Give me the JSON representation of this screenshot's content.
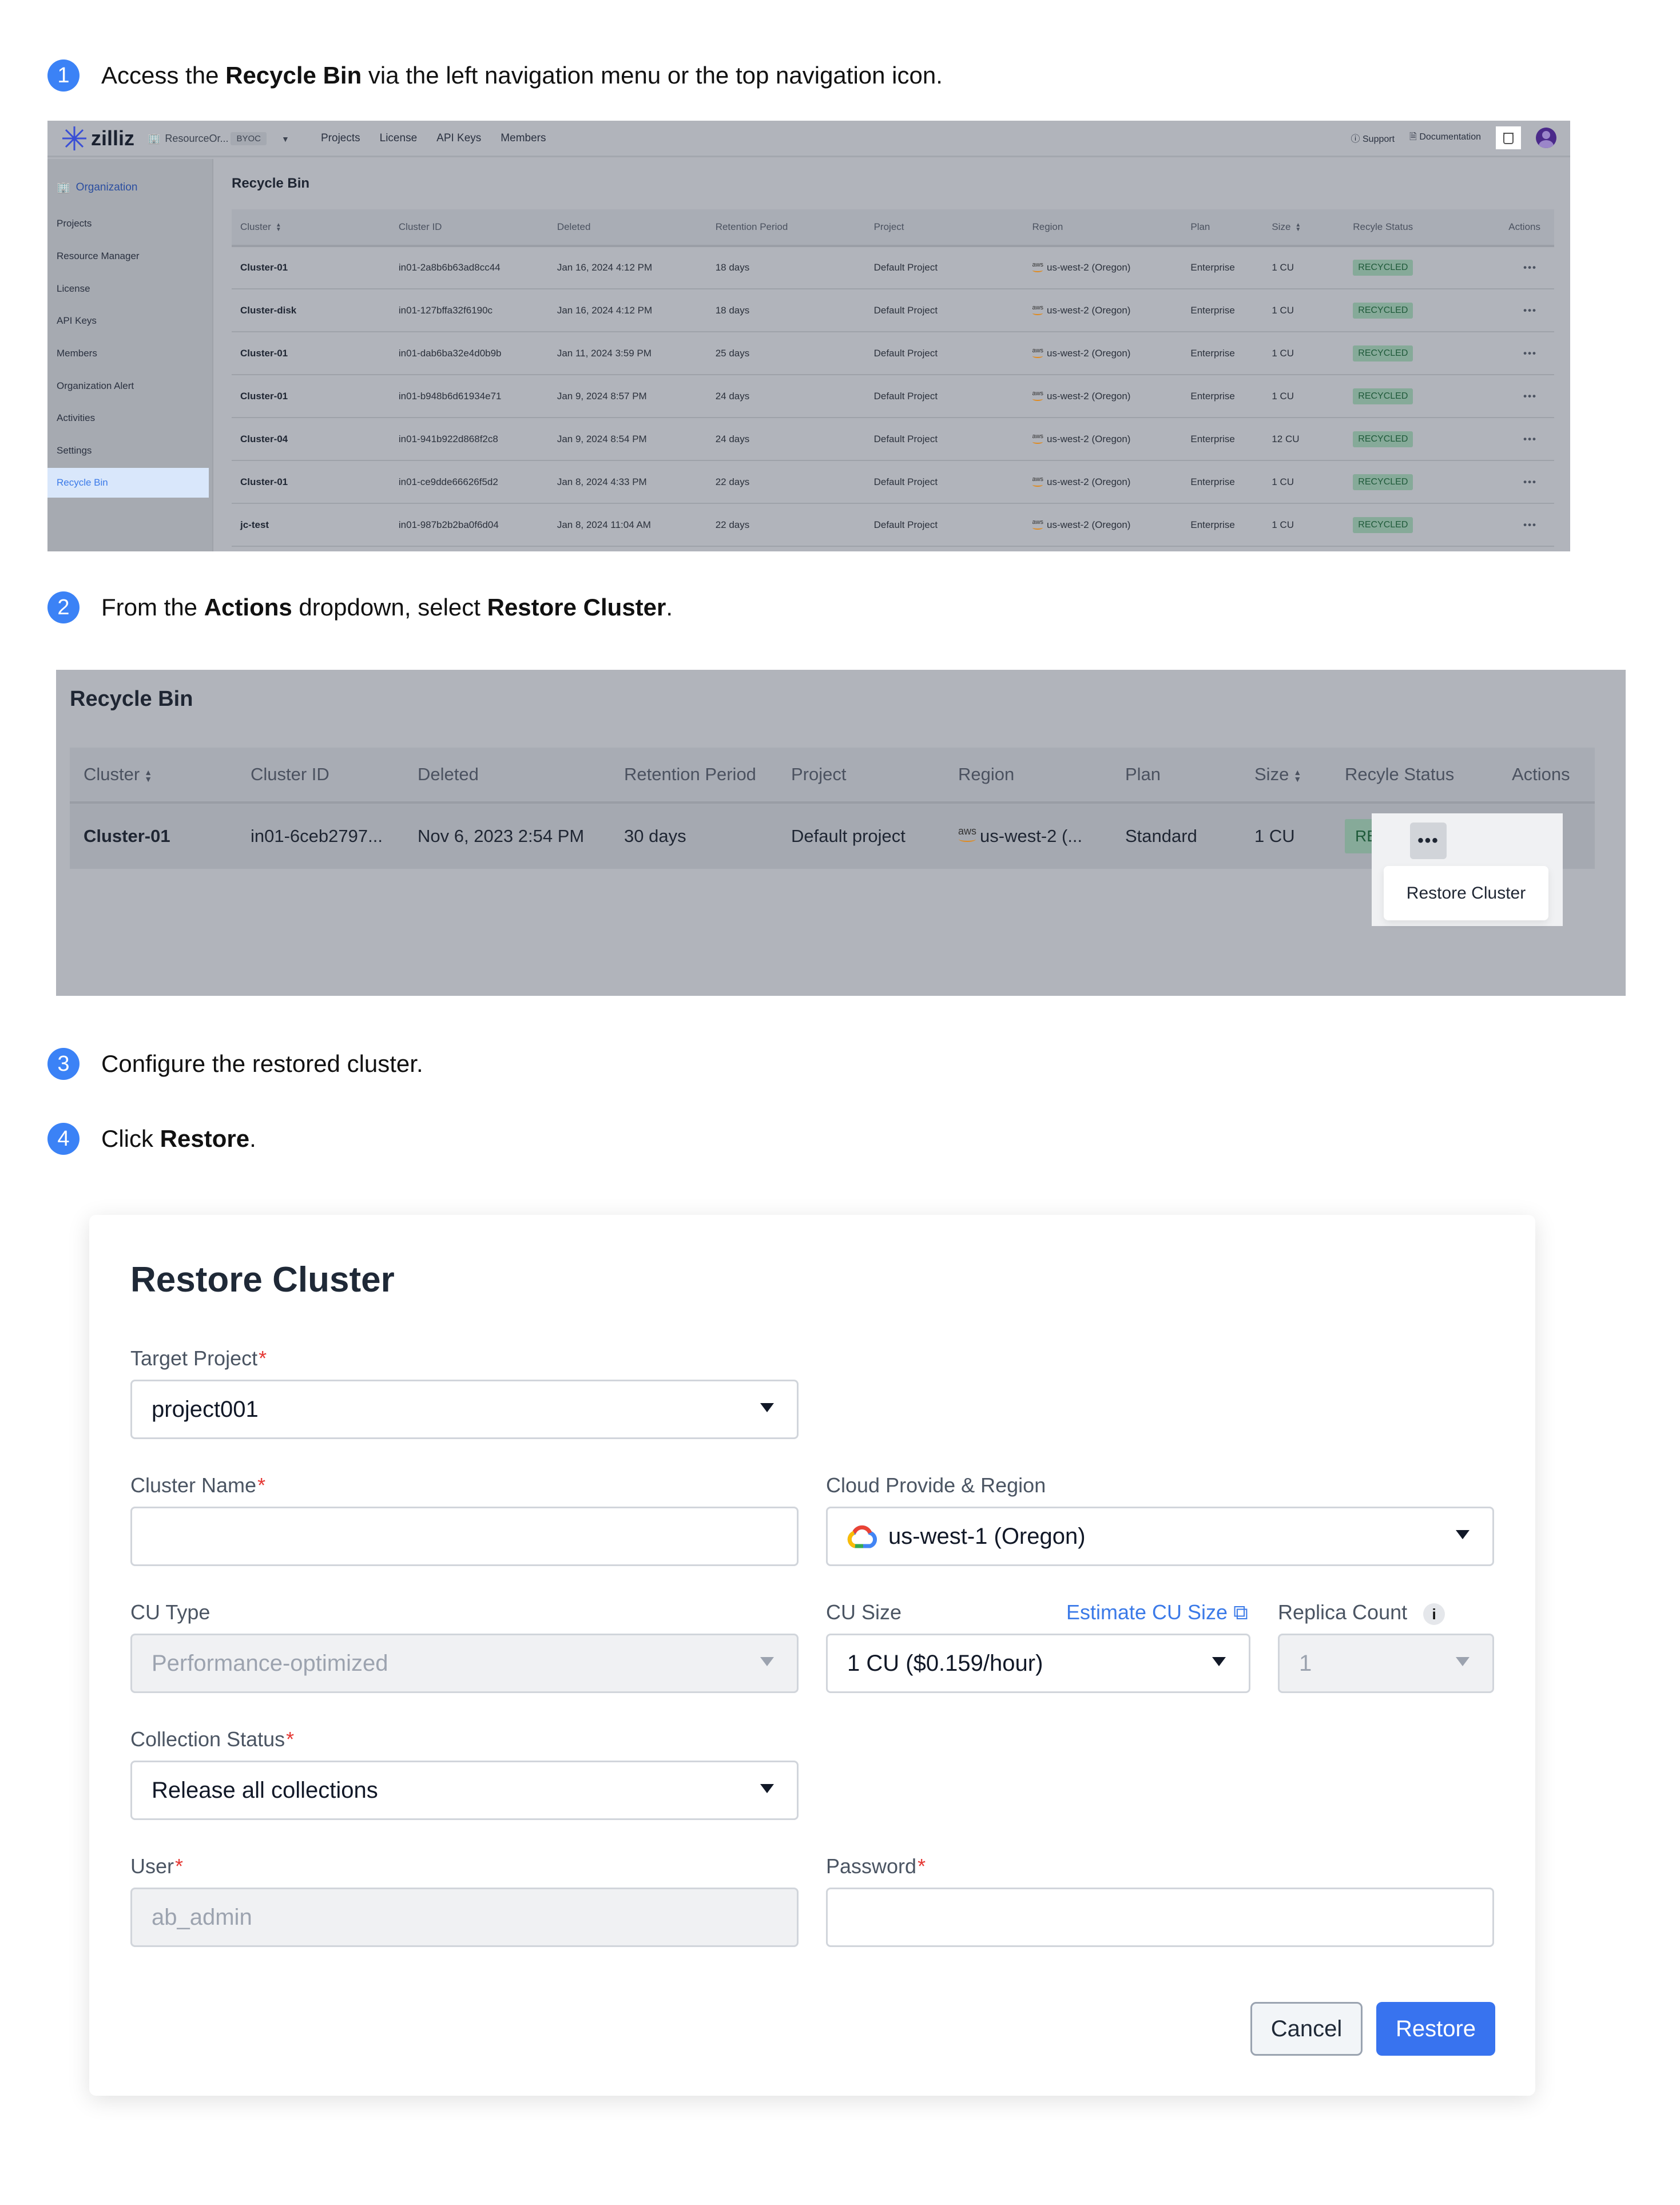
{
  "steps": [
    {
      "num": "1",
      "pre": "Access the ",
      "bold": "Recycle Bin",
      "post": " via the left navigation menu or the top navigation icon."
    },
    {
      "num": "2",
      "pre": "From the ",
      "bold": "Actions",
      "mid": " dropdown, select ",
      "bold2": "Restore Cluster",
      "post": "."
    },
    {
      "num": "3",
      "text": "Configure the restored cluster."
    },
    {
      "num": "4",
      "pre": "Click ",
      "bold": "Restore",
      "post": "."
    }
  ],
  "console": {
    "brand": "zilliz",
    "org_name": "ResourceOr...",
    "org_badge": "BYOC",
    "nav": [
      "Projects",
      "License",
      "API Keys",
      "Members"
    ],
    "support": "Support",
    "documentation": "Documentation",
    "sidebar": {
      "org": "Organization",
      "items": [
        "Projects",
        "Resource Manager",
        "License",
        "API Keys",
        "Members",
        "Organization Alert",
        "Activities",
        "Settings"
      ],
      "active": "Recycle Bin"
    },
    "page_title": "Recycle Bin",
    "columns": [
      "Cluster",
      "Cluster ID",
      "Deleted",
      "Retention Period",
      "Project",
      "Region",
      "Plan",
      "Size",
      "Recyle Status",
      "Actions"
    ],
    "rows": [
      {
        "cluster": "Cluster-01",
        "id": "in01-2a8b6b63ad8cc44",
        "deleted": "Jan 16, 2024 4:12 PM",
        "retention": "18 days",
        "project": "Default Project",
        "region": "us-west-2 (Oregon)",
        "plan": "Enterprise",
        "size": "1 CU",
        "status": "RECYCLED"
      },
      {
        "cluster": "Cluster-disk",
        "id": "in01-127bffa32f6190c",
        "deleted": "Jan 16, 2024 4:12 PM",
        "retention": "18 days",
        "project": "Default Project",
        "region": "us-west-2 (Oregon)",
        "plan": "Enterprise",
        "size": "1 CU",
        "status": "RECYCLED"
      },
      {
        "cluster": "Cluster-01",
        "id": "in01-dab6ba32e4d0b9b",
        "deleted": "Jan 11, 2024 3:59 PM",
        "retention": "25 days",
        "project": "Default Project",
        "region": "us-west-2 (Oregon)",
        "plan": "Enterprise",
        "size": "1 CU",
        "status": "RECYCLED"
      },
      {
        "cluster": "Cluster-01",
        "id": "in01-b948b6d61934e71",
        "deleted": "Jan 9, 2024 8:57 PM",
        "retention": "24 days",
        "project": "Default Project",
        "region": "us-west-2 (Oregon)",
        "plan": "Enterprise",
        "size": "1 CU",
        "status": "RECYCLED"
      },
      {
        "cluster": "Cluster-04",
        "id": "in01-941b922d868f2c8",
        "deleted": "Jan 9, 2024 8:54 PM",
        "retention": "24 days",
        "project": "Default Project",
        "region": "us-west-2 (Oregon)",
        "plan": "Enterprise",
        "size": "12 CU",
        "status": "RECYCLED"
      },
      {
        "cluster": "Cluster-01",
        "id": "in01-ce9dde66626f5d2",
        "deleted": "Jan 8, 2024 4:33 PM",
        "retention": "22 days",
        "project": "Default Project",
        "region": "us-west-2 (Oregon)",
        "plan": "Enterprise",
        "size": "1 CU",
        "status": "RECYCLED"
      },
      {
        "cluster": "jc-test",
        "id": "in01-987b2b2ba0f6d04",
        "deleted": "Jan 8, 2024 11:04 AM",
        "retention": "22 days",
        "project": "Default Project",
        "region": "us-west-2 (Oregon)",
        "plan": "Enterprise",
        "size": "1 CU",
        "status": "RECYCLED"
      }
    ]
  },
  "actions_example": {
    "page_title": "Recycle Bin",
    "columns": [
      "Cluster",
      "Cluster ID",
      "Deleted",
      "Retention Period",
      "Project",
      "Region",
      "Plan",
      "Size",
      "Recyle Status",
      "Actions"
    ],
    "row": {
      "cluster": "Cluster-01",
      "id": "in01-6ceb2797...",
      "deleted": "Nov 6, 2023 2:54 PM",
      "retention": "30 days",
      "project": "Default project",
      "region": "us-west-2 (...",
      "plan": "Standard",
      "size": "1 CU",
      "status": "RECYCLED"
    },
    "menu_item": "Restore Cluster"
  },
  "dialog": {
    "title": "Restore Cluster",
    "target_project": {
      "label": "Target Project",
      "value": "project001"
    },
    "cluster_name": {
      "label": "Cluster Name",
      "value": ""
    },
    "cloud_region": {
      "label": "Cloud Provide & Region",
      "value": "us-west-1 (Oregon)"
    },
    "cu_type": {
      "label": "CU Type",
      "value": "Performance-optimized"
    },
    "cu_size": {
      "label": "CU Size",
      "value": "1 CU ($0.159/hour)",
      "estimate_link": "Estimate CU Size"
    },
    "replica_count": {
      "label": "Replica Count",
      "value": "1"
    },
    "collection_status": {
      "label": "Collection Status",
      "value": "Release all collections"
    },
    "user": {
      "label": "User",
      "value": "ab_admin"
    },
    "password": {
      "label": "Password",
      "value": ""
    },
    "required_mark": "*",
    "cancel_label": "Cancel",
    "restore_label": "Restore"
  },
  "colors": {
    "accent": "#3b82f6",
    "primary_button": "#3873ef",
    "badge_bg": "#86aa99",
    "required": "#e53935"
  }
}
